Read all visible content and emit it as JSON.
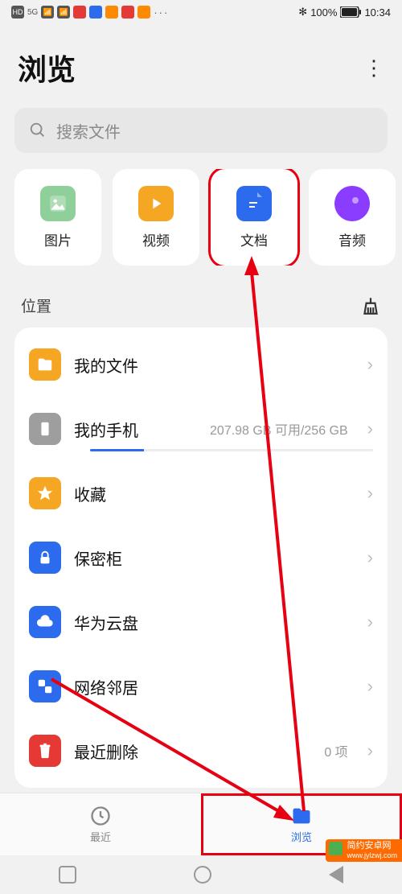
{
  "status": {
    "bt": "100%",
    "time": "10:34"
  },
  "header": {
    "title": "浏览"
  },
  "search": {
    "placeholder": "搜索文件"
  },
  "categories": [
    {
      "label": "图片",
      "icon": "image",
      "bg": "#8ecf9a"
    },
    {
      "label": "视频",
      "icon": "play",
      "bg": "#f5a623"
    },
    {
      "label": "文档",
      "icon": "doc",
      "bg": "#2c6bed",
      "highlight": true
    },
    {
      "label": "音频",
      "icon": "audio",
      "bg": "#8a3cff"
    }
  ],
  "section": {
    "title": "位置"
  },
  "rows": [
    {
      "icon": "folder",
      "bg": "#f5a623",
      "label": "我的文件"
    },
    {
      "icon": "phone",
      "bg": "#9e9e9e",
      "label": "我的手机",
      "info": "207.98 GB 可用/256 GB",
      "progress": 19
    },
    {
      "icon": "star",
      "bg": "#f5a623",
      "label": "收藏"
    },
    {
      "icon": "lock",
      "bg": "#2c6bed",
      "label": "保密柜"
    },
    {
      "icon": "cloud",
      "bg": "#2c6bed",
      "label": "华为云盘"
    },
    {
      "icon": "network",
      "bg": "#2c6bed",
      "label": "网络邻居"
    },
    {
      "icon": "trash",
      "bg": "#e53935",
      "label": "最近删除",
      "info": "0 项"
    }
  ],
  "nav": [
    {
      "label": "最近",
      "icon": "clock"
    },
    {
      "label": "浏览",
      "icon": "folder",
      "active": true,
      "highlight": true
    }
  ],
  "watermark": {
    "line1": "简约安卓网",
    "line2": "www.jylzwj.com"
  }
}
